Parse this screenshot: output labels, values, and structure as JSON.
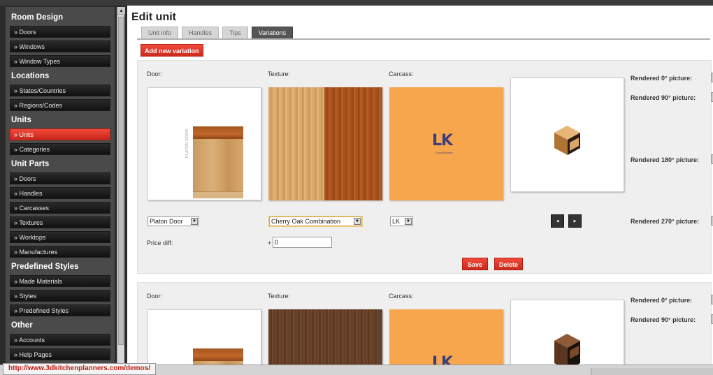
{
  "sidebar": {
    "sections": [
      {
        "title": "Room Design",
        "items": [
          "» Doors",
          "» Windows",
          "» Window Types"
        ]
      },
      {
        "title": "Locations",
        "items": [
          "» States/Countries",
          "» Regions/Codes"
        ]
      },
      {
        "title": "Units",
        "items": [
          "» Units",
          "» Categories"
        ],
        "active_index": 0
      },
      {
        "title": "Unit Parts",
        "items": [
          "» Doors",
          "» Handles",
          "» Carcasses",
          "» Textures",
          "» Worktops",
          "» Manufactures"
        ]
      },
      {
        "title": "Predefined Styles",
        "items": [
          "» Made Materials",
          "» Styles",
          "» Predefined Styles"
        ]
      },
      {
        "title": "Other",
        "items": [
          "» Accounts",
          "» Help Pages"
        ]
      }
    ]
  },
  "main": {
    "title": "Edit unit",
    "tabs": [
      "Unit info",
      "Handles",
      "Tips",
      "Variations"
    ],
    "active_tab": "Variations",
    "add_variation_label": "Add new variation",
    "variation1": {
      "door_label": "Door:",
      "texture_label": "Texture:",
      "carcass_label": "Carcass:",
      "door_brand": "PLATON DOOR",
      "carcass_logo": "LK",
      "carcass_logo_sub": "Luxus Kitchens",
      "door_select": "Platon Door",
      "texture_select": "Cherry Oak Combination",
      "carcass_select": "LK",
      "price_diff_label": "Price diff:",
      "price_sign": "+",
      "price_value": "0",
      "save_label": "Save",
      "delete_label": "Delete",
      "prev_arrow": "◀",
      "next_arrow": "▶",
      "rendered": [
        "Rendered 0° picture:",
        "Rendered 90° picture:",
        "Rendered 180° picture:",
        "Rendered 270° picture:"
      ]
    },
    "variation2": {
      "door_label": "Door:",
      "texture_label": "Texture:",
      "carcass_label": "Carcass:",
      "carcass_logo": "LK",
      "rendered": [
        "Rendered 0° picture:",
        "Rendered 90° picture:"
      ]
    }
  },
  "status": {
    "url": "http://www.3dkitchenplanners.com/demos/"
  },
  "colors": {
    "accent": "#e0362a",
    "sidebar_bg": "#4a4a4a",
    "carcass_orange": "#f8a64e"
  }
}
